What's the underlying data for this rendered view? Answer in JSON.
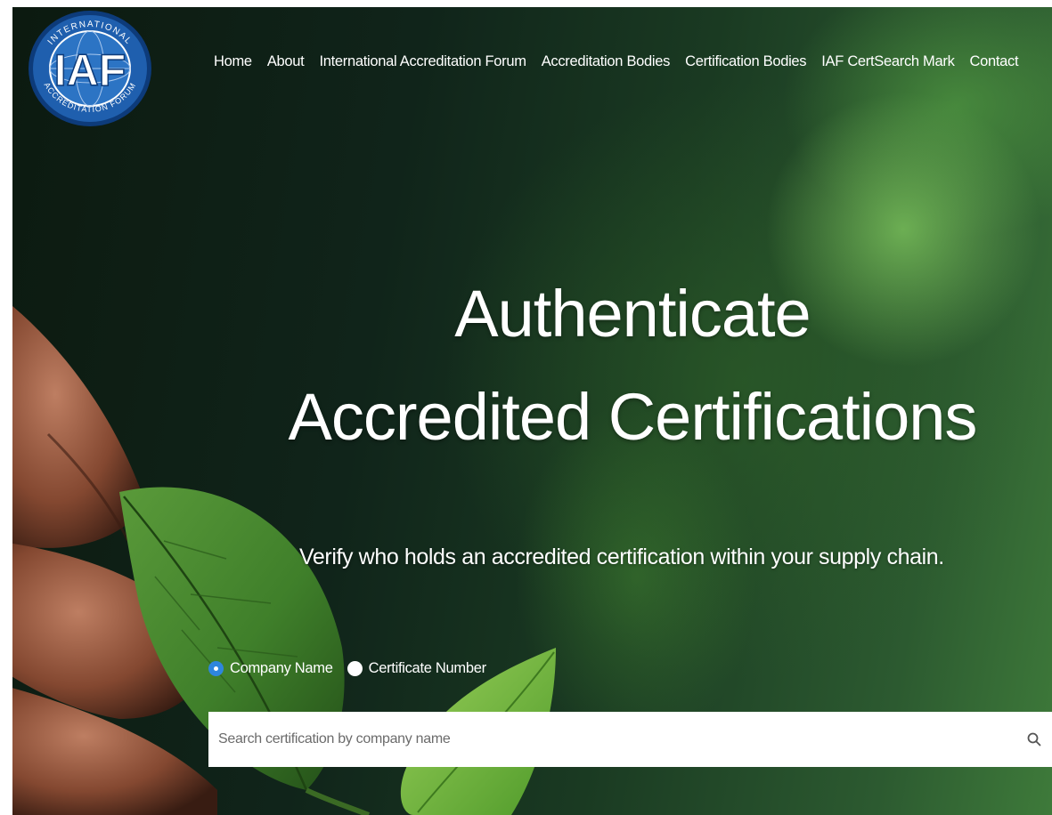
{
  "logo": {
    "top_text": "INTERNATIONAL",
    "center_text": "IAF",
    "bottom_text": "ACCREDITATION FORUM",
    "color_primary": "#1f5fae",
    "color_border": "#0d3b7a"
  },
  "nav": {
    "items": [
      {
        "label": "Home"
      },
      {
        "label": "About"
      },
      {
        "label": "International Accreditation Forum"
      },
      {
        "label": "Accreditation Bodies"
      },
      {
        "label": "Certification Bodies"
      },
      {
        "label": "IAF CertSearch Mark"
      },
      {
        "label": "Contact"
      }
    ]
  },
  "hero": {
    "headline_line1": "Authenticate",
    "headline_line2": "Accredited Certifications",
    "subtitle": "Verify who holds an accredited certification within your supply chain."
  },
  "search_mode": {
    "options": [
      {
        "label": "Company Name",
        "checked": true
      },
      {
        "label": "Certificate Number",
        "checked": false
      }
    ]
  },
  "search": {
    "placeholder": "Search certification by company name",
    "value": "",
    "button_icon": "search-icon"
  },
  "colors": {
    "accent": "#2e86de",
    "text_on_hero": "#ffffff"
  }
}
